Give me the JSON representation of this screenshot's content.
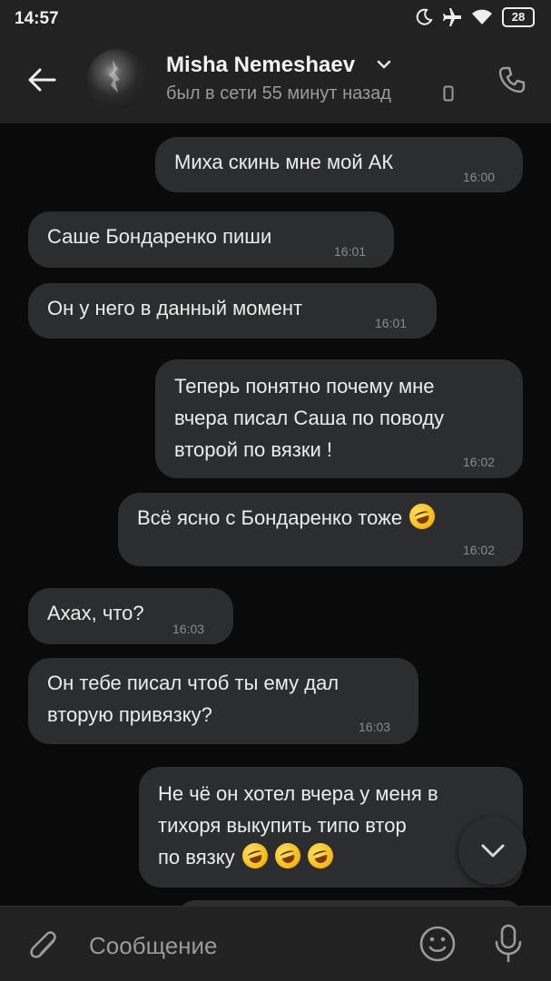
{
  "status": {
    "time": "14:57",
    "battery": "28"
  },
  "header": {
    "name": "Misha Nemeshaev",
    "last_seen": "был в сети 55 минут назад"
  },
  "messages": [
    {
      "dir": "out",
      "text": "Миха скинь мне мой АК",
      "time": "16:00"
    },
    {
      "dir": "in",
      "text": "Саше Бондаренко пиши",
      "time": "16:01"
    },
    {
      "dir": "in",
      "text": "Он у него в данный момент",
      "time": "16:01"
    },
    {
      "dir": "out",
      "lines": [
        "Теперь понятно почему мне",
        "вчера писал Саша по поводу",
        "второй по вязки !"
      ],
      "time": "16:02"
    },
    {
      "dir": "out",
      "text": "Всё ясно с Бондаренко тоже",
      "emoji": "rofl-emoji",
      "time": "16:02"
    },
    {
      "dir": "in",
      "text": "Ахах, что?",
      "time": "16:03"
    },
    {
      "dir": "in",
      "lines": [
        "Он тебе писал чтоб ты ему дал",
        "вторую привязку?"
      ],
      "time": "16:03"
    },
    {
      "dir": "out",
      "lines": [
        "Не чё он хотел вчера у меня в",
        "тихоря выкупить типо втор",
        "по вязку"
      ],
      "emoji": "rofl-emoji"
    }
  ],
  "input": {
    "placeholder": "Сообщение"
  },
  "colors": {
    "background": "#0a0a0a",
    "bar": "#222222",
    "bubble": "#2c2d2e",
    "text": "#ececec",
    "muted": "#8a8a8a"
  }
}
